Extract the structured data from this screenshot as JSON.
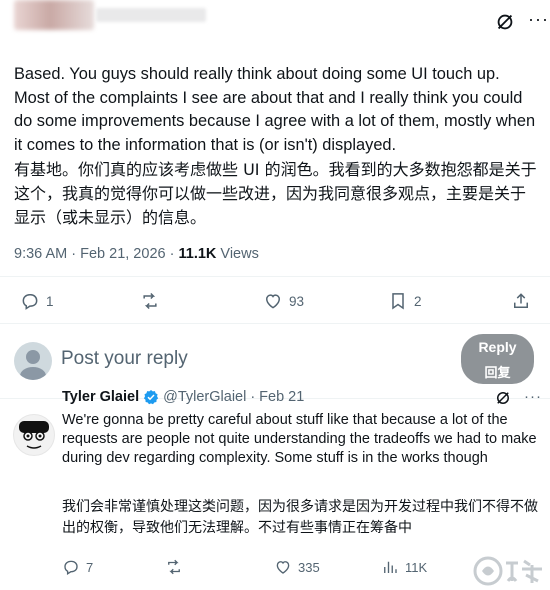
{
  "post": {
    "text_en": "Based. You guys should really think about doing some UI touch up. Most of the complaints I see are about that and I really think you could do some improvements because I agree with a lot of them, mostly when it comes to the information that is (or isn't) displayed.",
    "text_zh": "有基地。你们真的应该考虑做些 UI 的润色。我看到的大多数抱怨都是关于这个，我真的觉得你可以做一些改进，因为我同意很多观点，主要是关于显示（或未显示）的信息。",
    "time": "9:36 AM",
    "separator": "·",
    "date": "Feb 21, 2026",
    "views_count": "11.1K",
    "views_label": "Views",
    "actions": {
      "replies": "1",
      "reposts": "",
      "likes": "93",
      "bookmarks": "2"
    }
  },
  "composer": {
    "placeholder": "Post your reply",
    "button_label": "Reply",
    "button_label_zh": "回复"
  },
  "reply": {
    "name": "Tyler Glaiel",
    "handle": "@TylerGlaiel",
    "separator": "·",
    "date": "Feb 21",
    "text_en": "We're gonna be pretty careful about stuff like that because a lot of the requests are people not quite understanding the tradeoffs we had to make during dev regarding complexity. Some stuff is in the works though",
    "text_zh": "我们会非常谨慎处理这类问题，因为很多请求是因为开发过程中我们不得不做出的权衡，导致他们无法理解。不过有些事情正在筹备中",
    "actions": {
      "replies": "7",
      "reposts": "",
      "likes": "335",
      "views": "11K"
    }
  },
  "colors": {
    "text": "#0f1419",
    "secondary": "#536471",
    "verified": "#1d9bf0",
    "reply_button": "#8e9397"
  },
  "icons": [
    "grok-icon",
    "more-icon",
    "reply-icon",
    "repost-icon",
    "like-icon",
    "bookmark-icon",
    "share-icon",
    "analytics-icon",
    "verified-icon"
  ]
}
